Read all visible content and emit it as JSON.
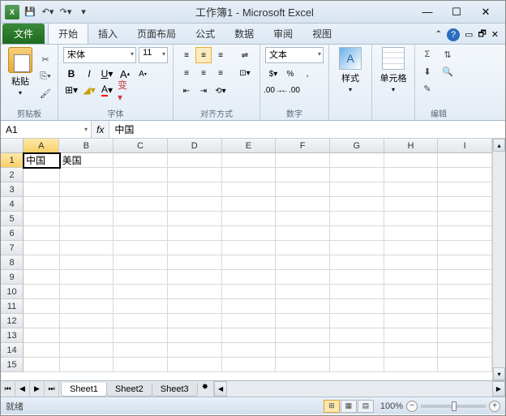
{
  "title": "工作簿1 - Microsoft Excel",
  "window": {
    "min": "—",
    "max": "☐",
    "close": "✕"
  },
  "ribbon_help": {
    "caret": "⌃",
    "help": "?",
    "shrink": "▭",
    "win": "🗗",
    "x": "✕"
  },
  "tabs": {
    "file": "文件",
    "home": "开始",
    "insert": "插入",
    "layout": "页面布局",
    "formulas": "公式",
    "data": "数据",
    "review": "审阅",
    "view": "视图"
  },
  "groups": {
    "clipboard": "剪贴板",
    "font": "字体",
    "alignment": "对齐方式",
    "number": "数字",
    "styles": "样式",
    "cells": "单元格",
    "editing": "编辑"
  },
  "clipboard": {
    "paste": "粘贴"
  },
  "font": {
    "name": "宋体",
    "size": "11",
    "bold": "B",
    "italic": "I",
    "underline": "U",
    "grow": "A",
    "shrink": "A"
  },
  "number": {
    "format": "文本"
  },
  "styles": {
    "btn": "样式"
  },
  "cellsgrp": {
    "btn": "单元格"
  },
  "edit": {
    "sigma": "Σ",
    "fill": "⬇",
    "clear": "✎"
  },
  "namebox": "A1",
  "fx": "fx",
  "formula_value": "中国",
  "columns": [
    "A",
    "B",
    "C",
    "D",
    "E",
    "F",
    "G",
    "H",
    "I"
  ],
  "rows": [
    "1",
    "2",
    "3",
    "4",
    "5",
    "6",
    "7",
    "8",
    "9",
    "10",
    "11",
    "12",
    "13",
    "14",
    "15"
  ],
  "celldata": {
    "A1": "中国",
    "B1": "美国"
  },
  "sheets": [
    "Sheet1",
    "Sheet2",
    "Sheet3"
  ],
  "status": "就绪",
  "zoom": "100%"
}
